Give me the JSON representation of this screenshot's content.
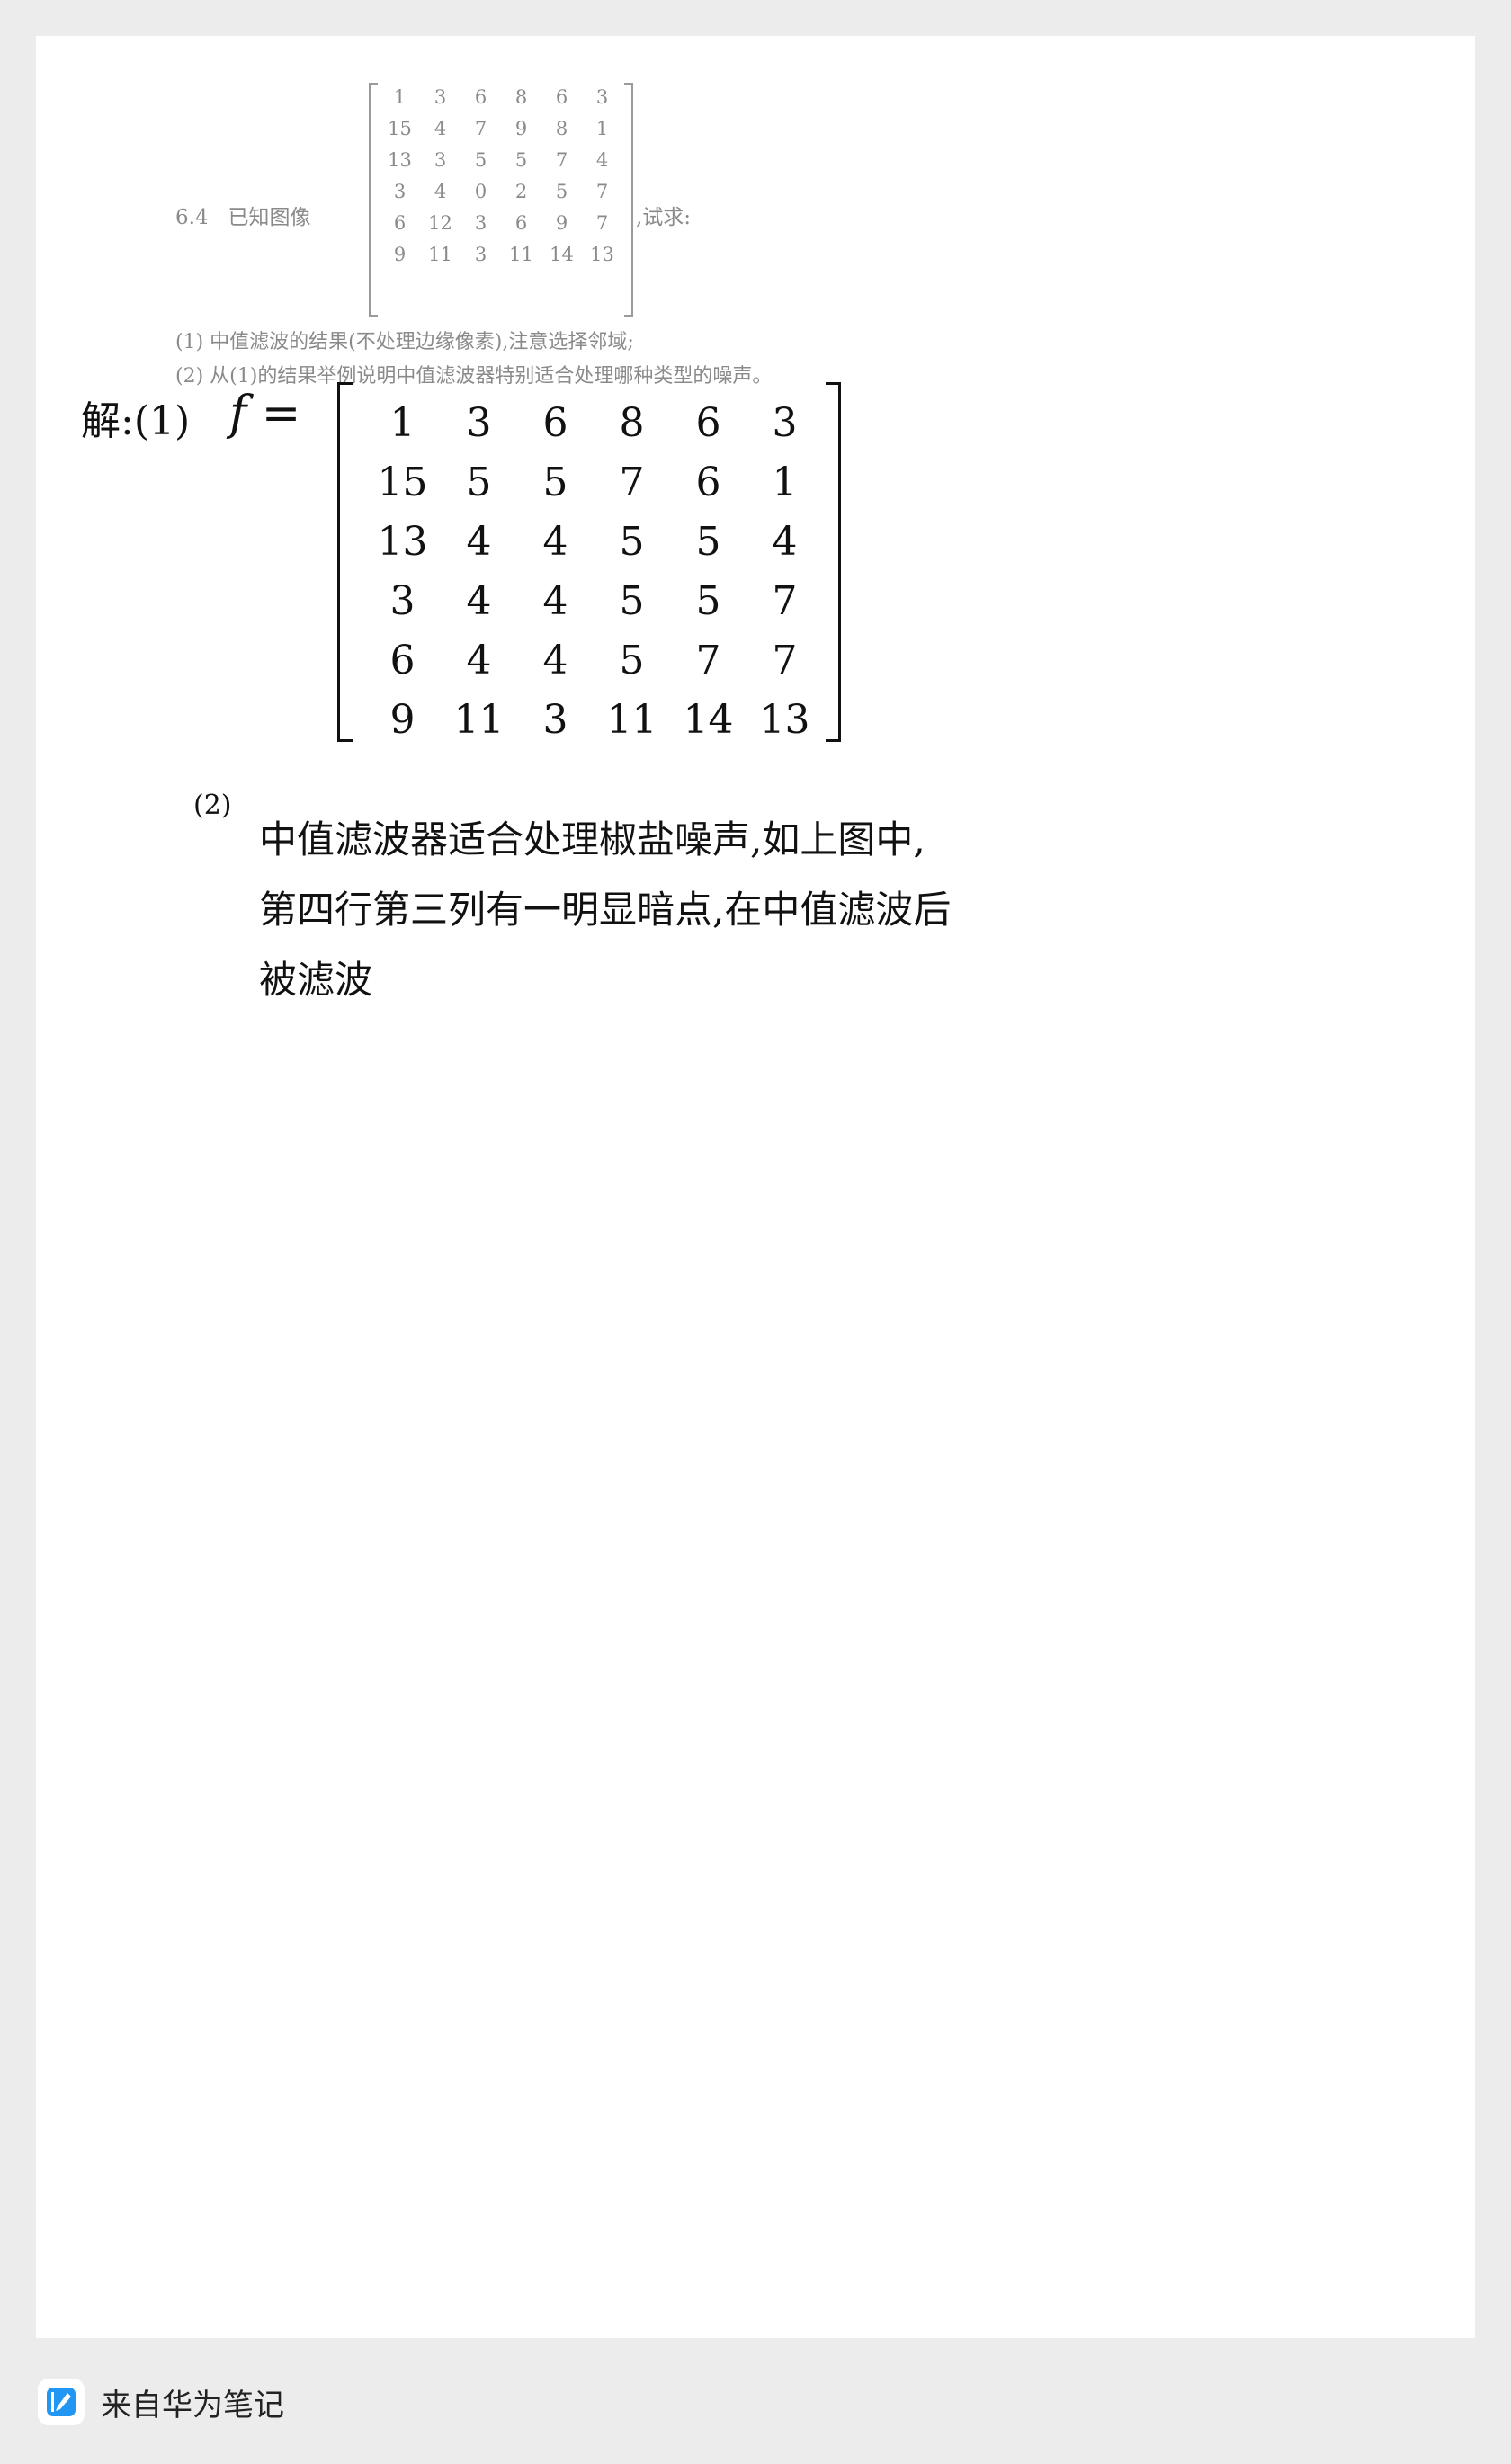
{
  "problem": {
    "number": "6.4",
    "intro": "已知图像",
    "tail": ",试求:",
    "matrix": [
      [
        "1",
        "3",
        "6",
        "8",
        "6",
        "3"
      ],
      [
        "15",
        "4",
        "7",
        "9",
        "8",
        "1"
      ],
      [
        "13",
        "3",
        "5",
        "5",
        "7",
        "4"
      ],
      [
        "3",
        "4",
        "0",
        "2",
        "5",
        "7"
      ],
      [
        "6",
        "12",
        "3",
        "6",
        "9",
        "7"
      ],
      [
        "9",
        "11",
        "3",
        "11",
        "14",
        "13"
      ]
    ],
    "q1": "(1) 中值滤波的结果(不处理边缘像素),注意选择邻域;",
    "q2": "(2) 从(1)的结果举例说明中值滤波器特别适合处理哪种类型的噪声。"
  },
  "solution": {
    "label": "解:(1)",
    "f_label": "f =",
    "matrix": [
      [
        "1",
        "3",
        "6",
        "8",
        "6",
        "3"
      ],
      [
        "15",
        "5",
        "5",
        "7",
        "6",
        "1"
      ],
      [
        "13",
        "4",
        "4",
        "5",
        "5",
        "4"
      ],
      [
        "3",
        "4",
        "4",
        "5",
        "5",
        "7"
      ],
      [
        "6",
        "4",
        "4",
        "5",
        "7",
        "7"
      ],
      [
        "9",
        "11",
        "3",
        "11",
        "14",
        "13"
      ]
    ],
    "part2_label": "(2)",
    "part2_lines": [
      "中值滤波器适合处理椒盐噪声,如上图中,",
      "第四行第三列有一明显暗点,在中值滤波后",
      "被滤波"
    ]
  },
  "footer": {
    "text": "来自华为笔记",
    "icon": "notes-app-icon",
    "icon_color": "#2196f3"
  }
}
